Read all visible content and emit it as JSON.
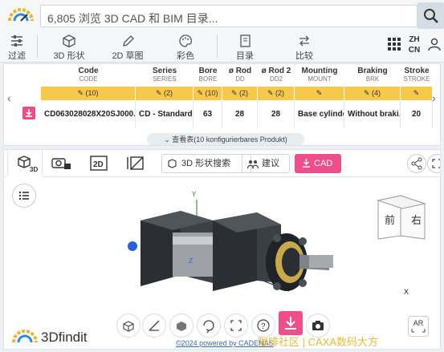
{
  "search": {
    "placeholder": "6,805 浏览 3D CAD 和 BIM 目录..."
  },
  "toolbar": {
    "items": [
      {
        "label": "过滤",
        "icon": "filter-sliders-icon"
      },
      {
        "label": "3D 形状",
        "icon": "cube-icon"
      },
      {
        "label": "2D 草图",
        "icon": "pencil-icon"
      },
      {
        "label": "彩色",
        "icon": "palette-icon"
      },
      {
        "label": "目录",
        "icon": "catalog-icon"
      },
      {
        "label": "比较",
        "icon": "compare-arrows-icon"
      }
    ],
    "language": {
      "top": "ZH",
      "bottom": "CN"
    }
  },
  "table": {
    "columns": [
      {
        "name": "Code",
        "sub": "CODE",
        "filter": "(10)"
      },
      {
        "name": "Series",
        "sub": "SERIES",
        "filter": "(2)"
      },
      {
        "name": "Bore",
        "sub": "BORE",
        "filter": "(10)"
      },
      {
        "name": "ø Rod",
        "sub": "DD",
        "filter": "(2)"
      },
      {
        "name": "ø Rod 2",
        "sub": "DD2",
        "filter": "(2)"
      },
      {
        "name": "Mounting",
        "sub": "MOUNT",
        "filter": ""
      },
      {
        "name": "Braking",
        "sub": "BRK",
        "filter": "(4)"
      },
      {
        "name": "Stroke",
        "sub": "STROKE",
        "filter": ""
      }
    ],
    "row": [
      "CD063028028X20SJ000...",
      "CD - Standard",
      "63",
      "28",
      "28",
      "Base cylinder",
      "Without braki...",
      "20"
    ],
    "view_table_label": "查看表(10 konfigurierbares Produkt)"
  },
  "viewer": {
    "tabs": [
      "3D",
      "",
      "2D",
      ""
    ],
    "shape_search_label": "3D 形状搜索",
    "suggest_label": "建议",
    "cad_label": "CAD",
    "cube_front": "前",
    "cube_right": "右",
    "axis_x": "X",
    "axis_y": "Y",
    "axis_z": "Z",
    "ar_label": "AR",
    "copyright": "©2024 powered by CADENAS",
    "brand": "3Dfindit"
  },
  "watermark": "咖啡社区 | CAXA数码大方",
  "colors": {
    "accent_pink": "#ee4e8a",
    "filter_yellow": "#f6c94c"
  }
}
